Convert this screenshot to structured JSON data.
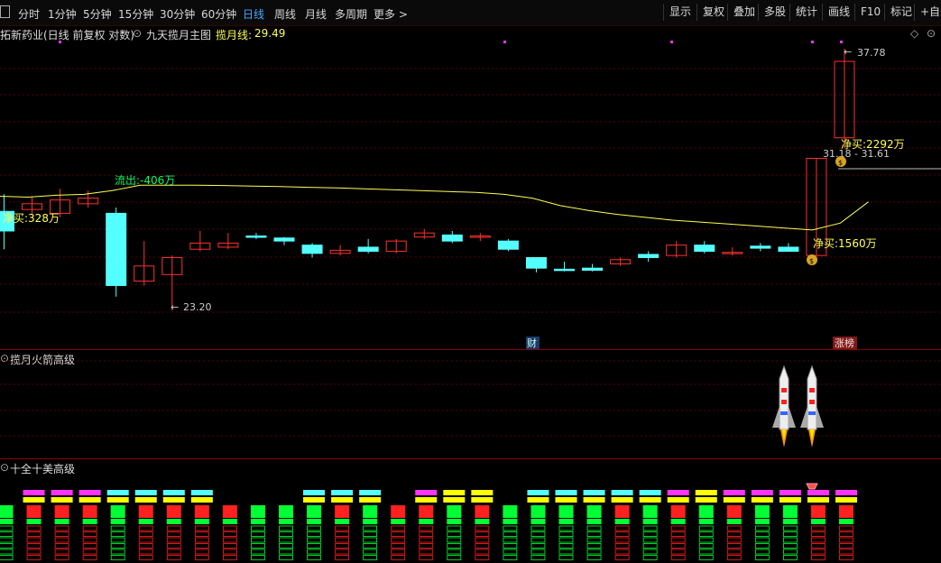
{
  "toolbar": {
    "periods": [
      "分时",
      "1分钟",
      "5分钟",
      "15分钟",
      "30分钟",
      "60分钟",
      "日线",
      "周线",
      "月线",
      "多周期",
      "更多 >"
    ],
    "active": "日线",
    "right": [
      "显示",
      "复权",
      "叠加",
      "多股",
      "统计",
      "画线",
      "F10",
      "标记",
      "+自选"
    ]
  },
  "main": {
    "stock_label": "拓新药业(日线 前复权 对数)",
    "indicator_label": "九天揽月主图",
    "ma_label": "揽月线:",
    "ma_value": "29.49",
    "high_price": "37.78",
    "low_price": "23.20",
    "price_range": "31.18 - 31.61",
    "annotations": {
      "net_buy_1": "净买:328万",
      "outflow": "流出:-406万",
      "net_buy_2": "净买:1560万",
      "net_buy_3": "净买:2292万"
    },
    "tags": {
      "cai": "财",
      "zhangbang": "涨榜"
    }
  },
  "panel2": {
    "title": "揽月火箭高级"
  },
  "panel3": {
    "title": "十全十美高级"
  },
  "colors": {
    "up": "#ff3030",
    "down": "#54ffff",
    "ma": "#ffff55",
    "green": "#00ff00",
    "magenta": "#ff33ff",
    "yellow": "#ffff00",
    "red": "#ff2020"
  },
  "chart_data": {
    "type": "candlestick",
    "candles": [
      {
        "o": 27.9,
        "c": 26.9,
        "h": 28.8,
        "l": 26.0
      },
      {
        "o": 28.0,
        "c": 28.3,
        "h": 28.7,
        "l": 27.7
      },
      {
        "o": 27.8,
        "c": 28.5,
        "h": 29.1,
        "l": 27.6
      },
      {
        "o": 28.3,
        "c": 28.6,
        "h": 29.0,
        "l": 28.1
      },
      {
        "o": 27.8,
        "c": 24.3,
        "h": 28.1,
        "l": 23.8
      },
      {
        "o": 24.5,
        "c": 25.2,
        "h": 26.4,
        "l": 24.3
      },
      {
        "o": 24.8,
        "c": 25.6,
        "h": 25.7,
        "l": 23.2
      },
      {
        "o": 26.0,
        "c": 26.3,
        "h": 26.9,
        "l": 25.9
      },
      {
        "o": 26.1,
        "c": 26.3,
        "h": 26.8,
        "l": 26.0
      },
      {
        "o": 26.65,
        "c": 26.6,
        "h": 26.8,
        "l": 26.5
      },
      {
        "o": 26.55,
        "c": 26.4,
        "h": 26.6,
        "l": 26.2
      },
      {
        "o": 26.2,
        "c": 25.8,
        "h": 26.3,
        "l": 25.6
      },
      {
        "o": 25.8,
        "c": 25.95,
        "h": 26.2,
        "l": 25.7
      },
      {
        "o": 26.1,
        "c": 25.9,
        "h": 26.5,
        "l": 25.8
      },
      {
        "o": 25.9,
        "c": 26.4,
        "h": 26.5,
        "l": 25.8
      },
      {
        "o": 26.6,
        "c": 26.8,
        "h": 27.0,
        "l": 26.5
      },
      {
        "o": 26.7,
        "c": 26.4,
        "h": 26.9,
        "l": 26.3
      },
      {
        "o": 26.65,
        "c": 26.65,
        "h": 26.8,
        "l": 26.4
      },
      {
        "o": 26.4,
        "c": 26.0,
        "h": 26.5,
        "l": 25.9
      },
      {
        "o": 25.6,
        "c": 25.1,
        "h": 25.6,
        "l": 24.9
      },
      {
        "o": 25.05,
        "c": 25.0,
        "h": 25.4,
        "l": 24.95
      },
      {
        "o": 25.1,
        "c": 25.0,
        "h": 25.3,
        "l": 24.95
      },
      {
        "o": 25.3,
        "c": 25.5,
        "h": 25.6,
        "l": 25.2
      },
      {
        "o": 25.75,
        "c": 25.6,
        "h": 25.9,
        "l": 25.4
      },
      {
        "o": 25.7,
        "c": 26.2,
        "h": 26.4,
        "l": 25.6
      },
      {
        "o": 26.2,
        "c": 25.9,
        "h": 26.4,
        "l": 25.8
      },
      {
        "o": 25.85,
        "c": 25.85,
        "h": 26.1,
        "l": 25.7
      },
      {
        "o": 26.15,
        "c": 26.05,
        "h": 26.3,
        "l": 25.9
      },
      {
        "o": 26.1,
        "c": 25.9,
        "h": 26.3,
        "l": 25.9
      },
      {
        "o": 25.7,
        "c": 30.8,
        "h": 30.8,
        "l": 25.7
      },
      {
        "o": 32.0,
        "c": 36.9,
        "h": 37.78,
        "l": 31.4
      }
    ],
    "ma": [
      28.7,
      28.65,
      28.75,
      28.8,
      29.0,
      29.3,
      29.3,
      29.3,
      29.28,
      29.25,
      29.22,
      29.18,
      29.15,
      29.1,
      29.05,
      29.0,
      28.95,
      28.9,
      28.8,
      28.6,
      28.2,
      27.95,
      27.75,
      27.6,
      27.45,
      27.35,
      27.25,
      27.15,
      27.05,
      26.95,
      27.3,
      28.4
    ]
  }
}
